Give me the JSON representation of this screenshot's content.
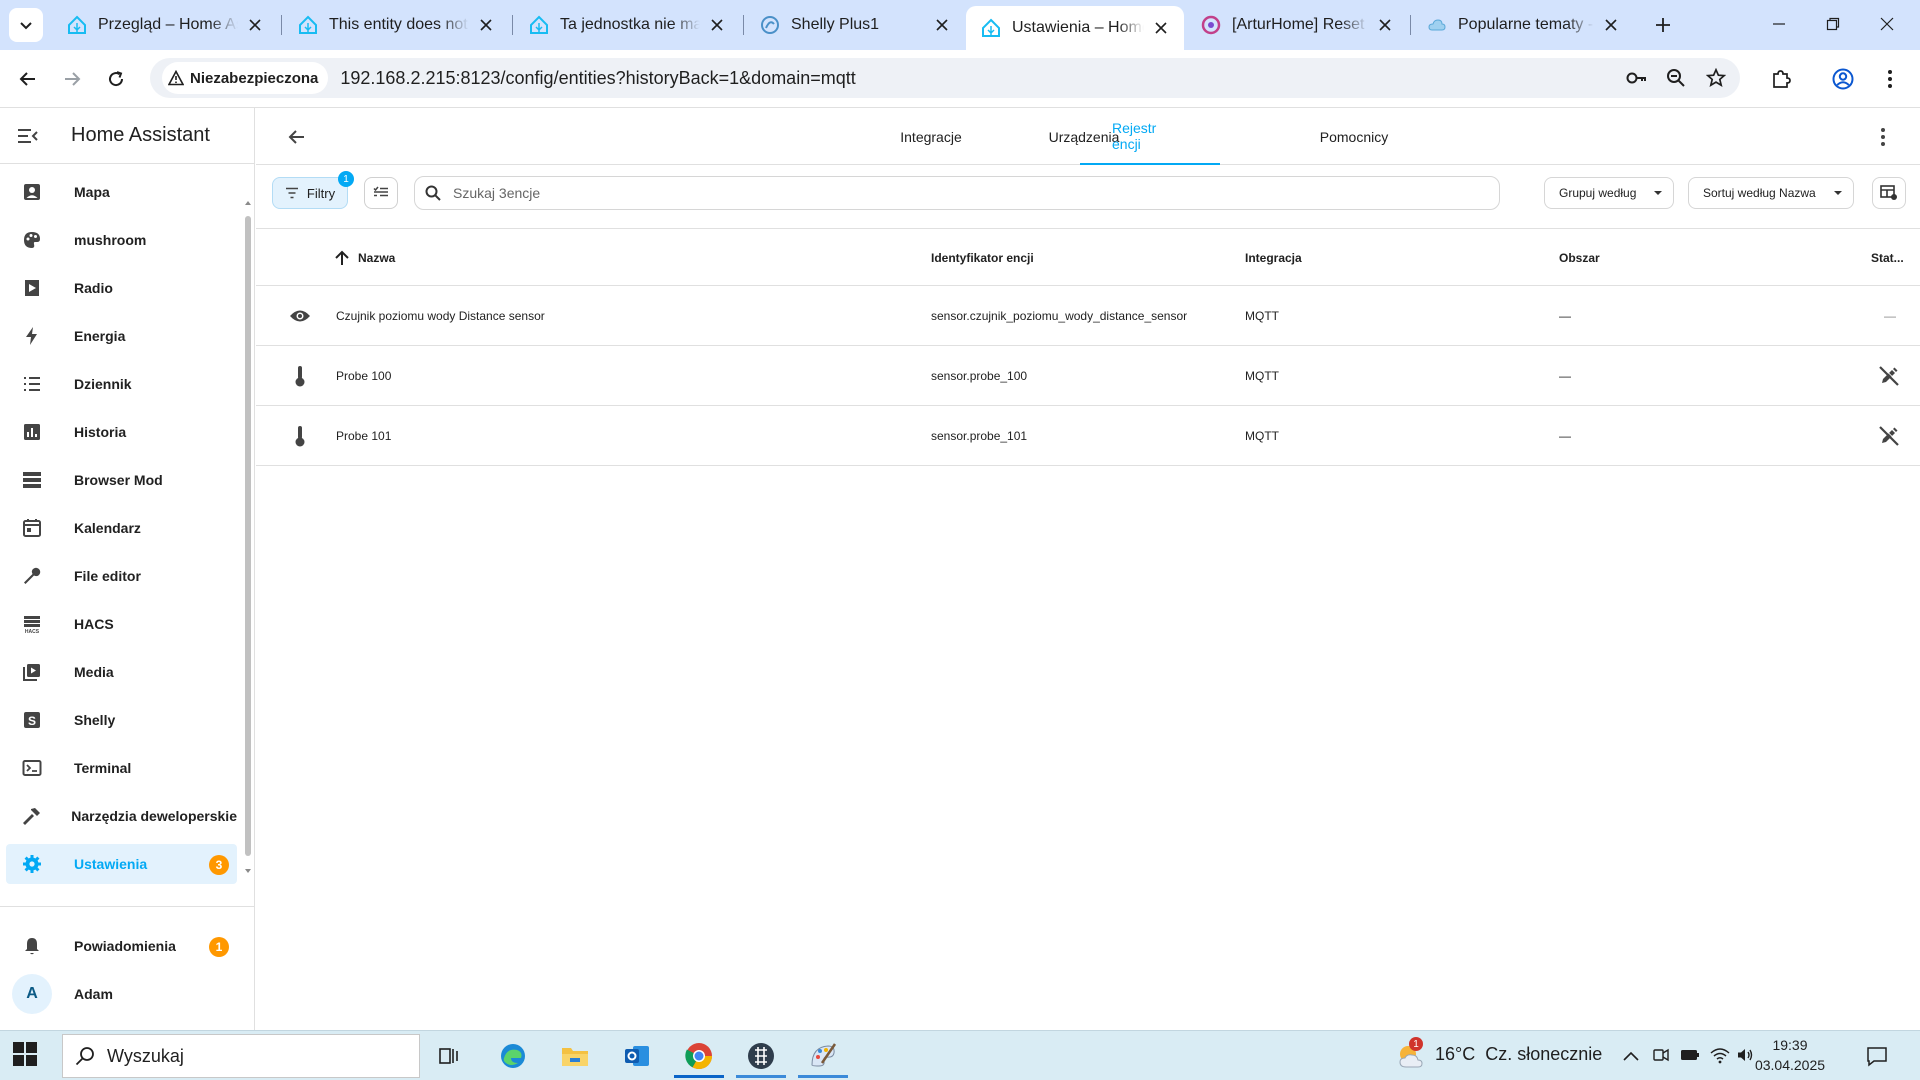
{
  "browser": {
    "tabs": [
      {
        "title": "Przegląd – Home Assistant",
        "favicon": "home-assistant-icon"
      },
      {
        "title": "This entity does not have a unique ID",
        "favicon": "home-assistant-icon"
      },
      {
        "title": "Ta jednostka nie ma unikalnego ID",
        "favicon": "home-assistant-icon"
      },
      {
        "title": "Shelly Plus1",
        "favicon": "shelly-icon"
      },
      {
        "title": "Ustawienia – Home Assistant",
        "favicon": "home-assistant-icon",
        "active": true
      },
      {
        "title": "[ArturHome] Reset haseł",
        "favicon": "arturhome-icon"
      },
      {
        "title": "Popularne tematy - ArturHome",
        "favicon": "cloud-icon"
      }
    ],
    "security_label": "Niezabezpieczona",
    "url": "192.168.2.215:8123/config/entities?historyBack=1&domain=mqtt"
  },
  "sidebar": {
    "title": "Home Assistant",
    "items": [
      {
        "label": "Mapa",
        "icon": "account-box-icon"
      },
      {
        "label": "mushroom",
        "icon": "palette-icon"
      },
      {
        "label": "Radio",
        "icon": "play-box-icon"
      },
      {
        "label": "Energia",
        "icon": "lightning-icon"
      },
      {
        "label": "Dziennik",
        "icon": "list-icon"
      },
      {
        "label": "Historia",
        "icon": "chart-box-icon"
      },
      {
        "label": "Browser Mod",
        "icon": "server-icon"
      },
      {
        "label": "Kalendarz",
        "icon": "calendar-icon"
      },
      {
        "label": "File editor",
        "icon": "wrench-icon"
      },
      {
        "label": "HACS",
        "icon": "hacs-icon"
      },
      {
        "label": "Media",
        "icon": "media-icon"
      },
      {
        "label": "Shelly",
        "icon": "shelly-box-icon"
      },
      {
        "label": "Terminal",
        "icon": "terminal-icon"
      },
      {
        "label": "Narzędzia deweloperskie",
        "icon": "hammer-icon"
      },
      {
        "label": "Ustawienia",
        "icon": "gear-icon",
        "badge": "3",
        "selected": true
      }
    ],
    "notifications": {
      "label": "Powiadomienia",
      "badge": "1"
    },
    "user": {
      "label": "Adam",
      "initial": "A"
    }
  },
  "main": {
    "tabs": [
      {
        "label": "Integracje"
      },
      {
        "label": "Urządzenia"
      },
      {
        "label": "Rejestr encji",
        "active": true
      },
      {
        "label": "Pomocnicy"
      }
    ],
    "filters_label": "Filtry",
    "filters_count": "1",
    "search_placeholder": "Szukaj 3encje",
    "group_by_label": "Grupuj według",
    "sort_by_label": "Sortuj według Nazwa",
    "columns": {
      "name": "Nazwa",
      "entity_id": "Identyfikator encji",
      "integration": "Integracja",
      "area": "Obszar",
      "status": "Stat..."
    },
    "rows": [
      {
        "icon": "eye-icon",
        "name": "Czujnik poziomu wody Distance sensor",
        "entity_id": "sensor.czujnik_poziomu_wody_distance_sensor",
        "integration": "MQTT",
        "area": "—",
        "status": "—",
        "status_icon": "none"
      },
      {
        "icon": "thermometer-icon",
        "name": "Probe 100",
        "entity_id": "sensor.probe_100",
        "integration": "MQTT",
        "area": "—",
        "status": "",
        "status_icon": "pencil-off-icon"
      },
      {
        "icon": "thermometer-icon",
        "name": "Probe 101",
        "entity_id": "sensor.probe_101",
        "integration": "MQTT",
        "area": "—",
        "status": "",
        "status_icon": "pencil-off-icon"
      }
    ]
  },
  "taskbar": {
    "search_label": "Wyszukaj",
    "weather_badge": "1",
    "weather_text": "16°C  Cz. słonecznie",
    "time": "19:39",
    "date": "03.04.2025"
  },
  "colors": {
    "accent": "#03a9f4",
    "badge": "#ff9800",
    "tabstrip": "#d3e3fd"
  }
}
